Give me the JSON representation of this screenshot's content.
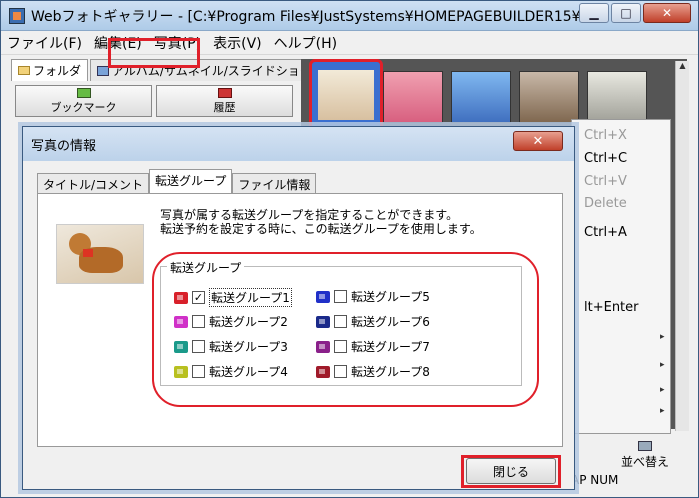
{
  "window": {
    "title": "Webフォトギャラリー - [C:¥Program Files¥JustSystems¥HOMEPAGEBUILDER15¥...",
    "min_icon": "minimize-icon",
    "max_icon": "maximize-icon",
    "close_icon": "close-icon",
    "min_glyph": "▁",
    "max_glyph": "□",
    "close_glyph": "✕"
  },
  "menubar": [
    "ファイル(F)",
    "編集(E)",
    "写真(P)",
    "表示(V)",
    "ヘルプ(H)"
  ],
  "left_pane": {
    "tabs": [
      "フォルダ",
      "アルバム/サムネイル/スライドショー"
    ],
    "bookmark_label": "ブックマーク",
    "history_label": "履歴"
  },
  "context_menu": {
    "shortcuts": [
      "Ctrl+X",
      "Ctrl+C",
      "Ctrl+V",
      "Delete",
      "Ctrl+A",
      "lt+Enter"
    ],
    "disabled": [
      true,
      false,
      true,
      true,
      false,
      false
    ],
    "submenu_arrow": "▸"
  },
  "status": {
    "caps": "AP",
    "num": "NUM",
    "sort_label": "並べ替え"
  },
  "dialog": {
    "title": "写真の情報",
    "close_glyph": "✕",
    "tabs": [
      "タイトル/コメント",
      "転送グループ",
      "ファイル情報"
    ],
    "active_tab": 1,
    "description_line1": "写真が属する転送グループを指定することができます。",
    "description_line2": "転送予約を設定する時に、この転送グループを使用します。",
    "group_legend": "転送グループ",
    "groups": [
      {
        "label": "転送グループ1",
        "flag_number": "1",
        "checked": true,
        "color": "#d8202a"
      },
      {
        "label": "転送グループ2",
        "flag_number": "2",
        "checked": false,
        "color": "#d030c8"
      },
      {
        "label": "転送グループ3",
        "flag_number": "3",
        "checked": false,
        "color": "#1a9a8a"
      },
      {
        "label": "転送グループ4",
        "flag_number": "4",
        "checked": false,
        "color": "#b8c020"
      },
      {
        "label": "転送グループ5",
        "flag_number": "5",
        "checked": false,
        "color": "#2030c8"
      },
      {
        "label": "転送グループ6",
        "flag_number": "6",
        "checked": false,
        "color": "#1a2a8a"
      },
      {
        "label": "転送グループ7",
        "flag_number": "7",
        "checked": false,
        "color": "#8a208a"
      },
      {
        "label": "転送グループ8",
        "flag_number": "8",
        "checked": false,
        "color": "#a01a2a"
      }
    ],
    "check_glyph": "✓",
    "close_button_label": "閉じる"
  },
  "colors": {
    "highlight": "#e0202a",
    "title_bar": "#bcd2ea"
  }
}
